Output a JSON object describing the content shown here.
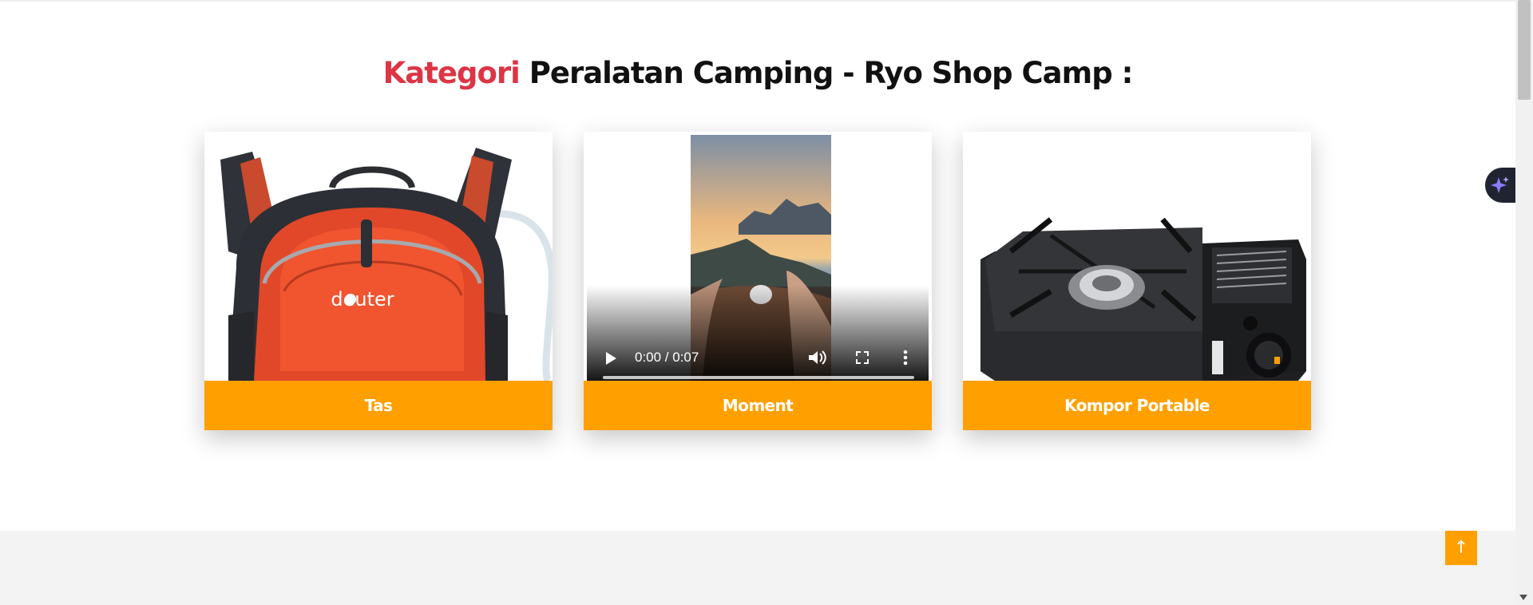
{
  "section": {
    "title_accent": "Kategori",
    "title_rest": " Peralatan Camping - Ryo Shop Camp :"
  },
  "cards": [
    {
      "label": "Tas",
      "media": "backpack-image",
      "brand_text": "deuter"
    },
    {
      "label": "Moment",
      "media": "video",
      "video_time": "0:00 / 0:07",
      "video_progress": 0
    },
    {
      "label": "Kompor Portable",
      "media": "portable-stove-image"
    }
  ],
  "scroll_to_top": {
    "icon": "arrow-up-icon",
    "glyph": "↑"
  },
  "colors": {
    "accent_red": "#dc3545",
    "orange": "#ffa000",
    "footer_bg": "#f3f3f3"
  }
}
